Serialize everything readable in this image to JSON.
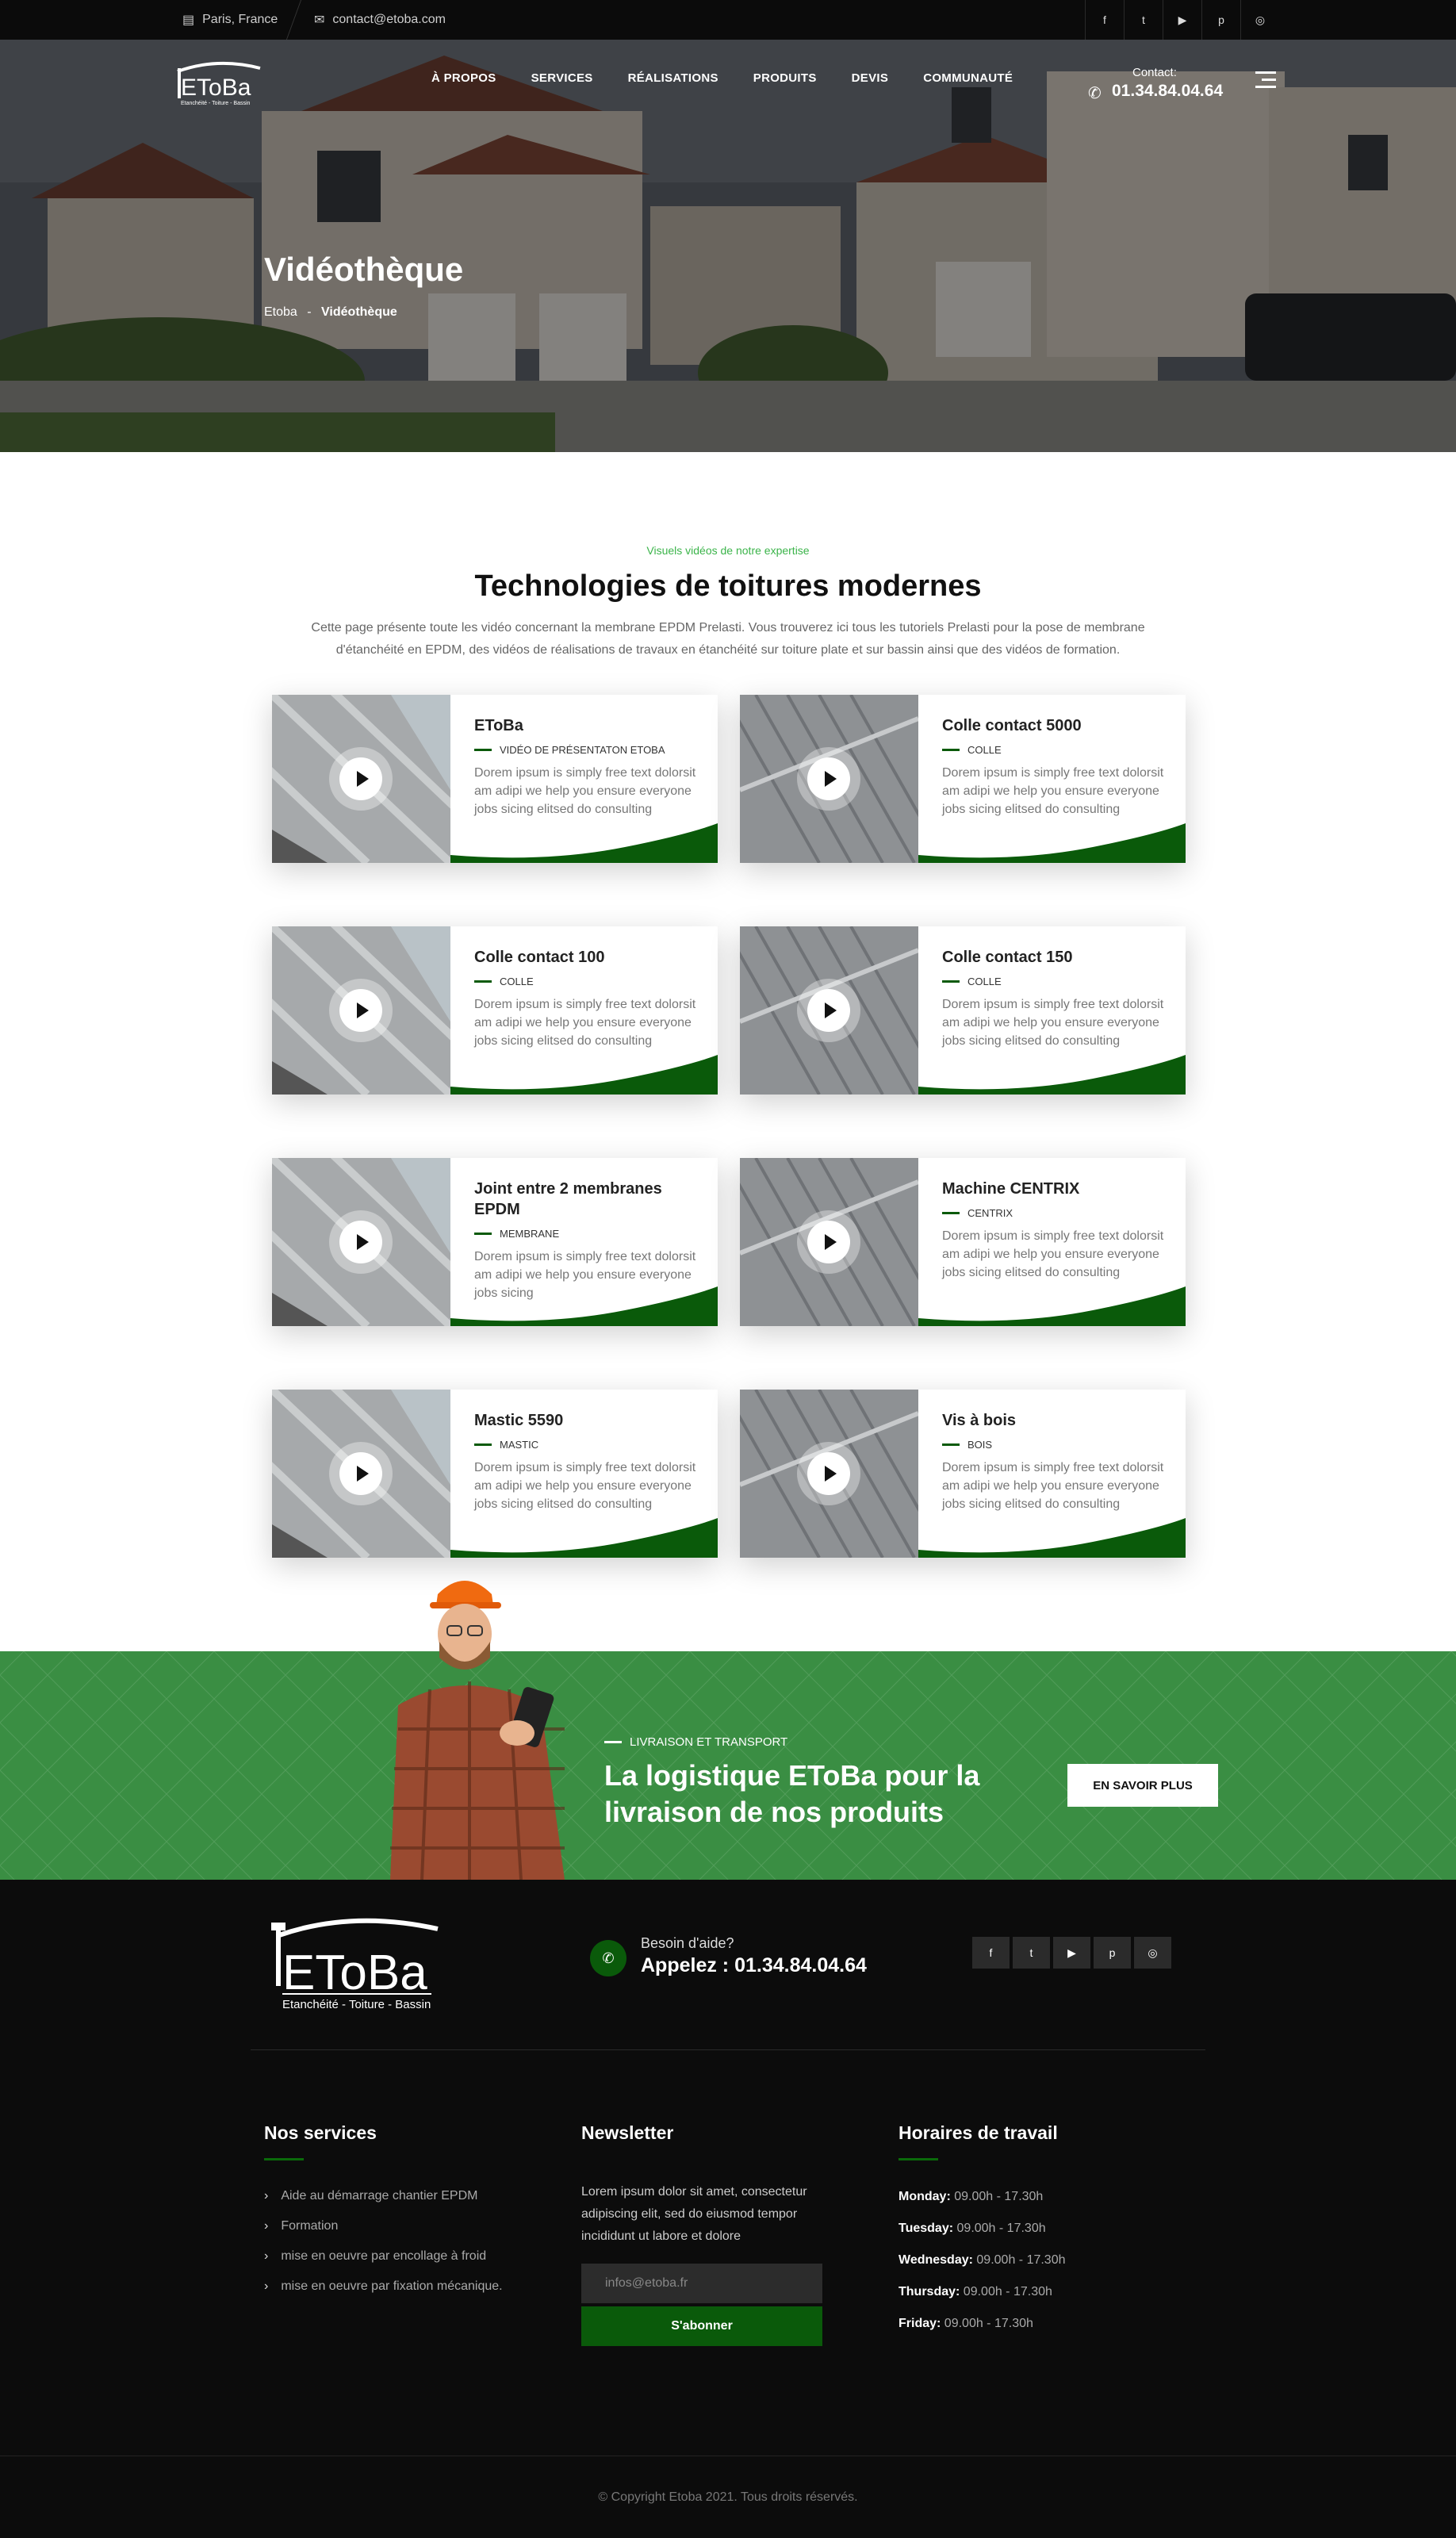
{
  "topbar": {
    "location": "Paris, France",
    "email": "contact@etoba.com",
    "socials": [
      "facebook-icon",
      "twitter-icon",
      "youtube-icon",
      "pinterest-icon",
      "instagram-icon"
    ]
  },
  "brand": {
    "logo_text": "EToBa",
    "logo_tagline": "Etanchéité - Toiture - Bassin"
  },
  "nav": [
    "À PROPOS",
    "SERVICES",
    "RÉALISATIONS",
    "PRODUITS",
    "DEVIS",
    "COMMUNAUTÉ"
  ],
  "header_contact": {
    "label": "Contact:",
    "phone": "01.34.84.04.64"
  },
  "hero": {
    "title": "Vidéothèque",
    "breadcrumb_home": "Etoba",
    "breadcrumb_sep": "-",
    "breadcrumb_current": "Vidéothèque"
  },
  "section": {
    "kicker": "Visuels vidéos de notre expertise",
    "title": "Technologies de toitures modernes",
    "intro": "Cette page présente toute les vidéo concernant la membrane EPDM Prelasti. Vous trouverez ici tous les tutoriels Prelasti pour la pose de membrane d'étanchéité en EPDM, des vidéos de réalisations de travaux en étanchéité sur toiture plate et sur bassin ainsi que des vidéos de formation."
  },
  "cards": [
    {
      "title": "EToBa",
      "category": "VIDÉO DE PRÉSENTATON ETOBA",
      "text": "Dorem ipsum is simply free text dolorsit am adipi we help you ensure everyone jobs sicing elitsed do consulting"
    },
    {
      "title": "Colle contact 5000",
      "category": "COLLE",
      "text": "Dorem ipsum is simply free text dolorsit am adipi we help you ensure everyone jobs sicing elitsed do consulting"
    },
    {
      "title": "Colle contact 100",
      "category": "COLLE",
      "text": "Dorem ipsum is simply free text dolorsit am adipi we help you ensure everyone jobs sicing elitsed do consulting"
    },
    {
      "title": "Colle contact 150",
      "category": "COLLE",
      "text": "Dorem ipsum is simply free text dolorsit am adipi we help you ensure everyone jobs sicing elitsed do consulting"
    },
    {
      "title": "Joint entre 2 membranes EPDM",
      "category": "MEMBRANE",
      "text": "Dorem ipsum is simply free text dolorsit am adipi we help you ensure everyone jobs sicing"
    },
    {
      "title": "Machine CENTRIX",
      "category": "CENTRIX",
      "text": "Dorem ipsum is simply free text dolorsit am adipi we help you ensure everyone jobs sicing elitsed do consulting"
    },
    {
      "title": "Mastic 5590",
      "category": "MASTIC",
      "text": "Dorem ipsum is simply free text dolorsit am adipi we help you ensure everyone jobs sicing elitsed do consulting"
    },
    {
      "title": "Vis à bois",
      "category": "BOIS",
      "text": "Dorem ipsum is simply free text dolorsit am adipi we help you ensure everyone jobs sicing elitsed do consulting"
    }
  ],
  "promo": {
    "kicker": "LIVRAISON ET TRANSPORT",
    "title": "La logistique EToBa pour la livraison de nos produits",
    "button": "EN SAVOIR PLUS"
  },
  "footer": {
    "help_label": "Besoin d'aide?",
    "help_phone": "Appelez : 01.34.84.04.64",
    "services_title": "Nos services",
    "services": [
      "Aide au démarrage chantier EPDM",
      "Formation",
      "mise en oeuvre par encollage à froid",
      "mise en oeuvre par fixation mécanique."
    ],
    "newsletter_title": "Newsletter",
    "newsletter_text": "Lorem ipsum dolor sit amet, consectetur adipiscing elit, sed do eiusmod tempor incididunt ut labore et dolore",
    "newsletter_placeholder": "infos@etoba.fr",
    "newsletter_button": "S'abonner",
    "hours_title": "Horaires de travail",
    "hours": [
      {
        "day": "Monday:",
        "time": "09.00h - 17.30h"
      },
      {
        "day": "Tuesday:",
        "time": "09.00h - 17.30h"
      },
      {
        "day": "Wednesday:",
        "time": "09.00h - 17.30h"
      },
      {
        "day": "Thursday:",
        "time": "09.00h - 17.30h"
      },
      {
        "day": "Friday:",
        "time": "09.00h - 17.30h"
      }
    ],
    "copyright": "© Copyright Etoba 2021. Tous droits réservés."
  },
  "colors": {
    "green": "#0a5a0a",
    "promo_green": "#3a8e43",
    "accent_text": "#3bb44a",
    "dark": "#0c0c0c"
  }
}
